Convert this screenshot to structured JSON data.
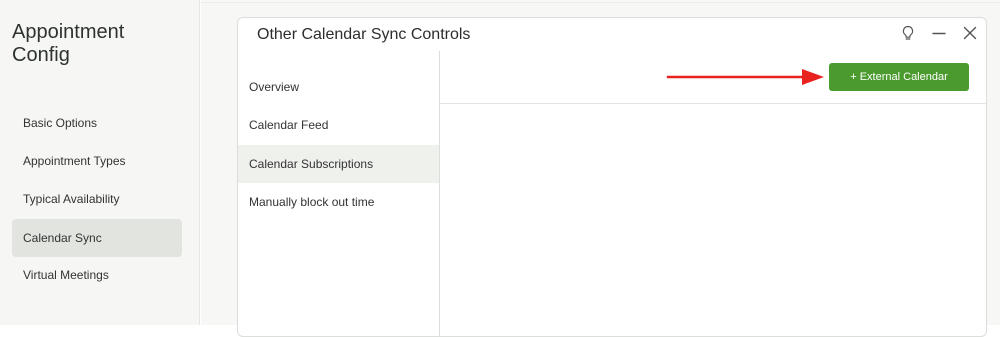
{
  "sidebar": {
    "title": "Appointment\nConfig",
    "items": [
      {
        "label": "Basic Options"
      },
      {
        "label": "Appointment Types"
      },
      {
        "label": "Typical Availability"
      },
      {
        "label": "Calendar Sync",
        "active": true
      },
      {
        "label": "Virtual Meetings"
      }
    ]
  },
  "panel": {
    "title": "Other Calendar Sync Controls",
    "controls": {
      "help_icon": "lightbulb-icon",
      "minimize_icon": "minimize-icon",
      "close_icon": "close-icon"
    },
    "tabs": [
      {
        "label": "Overview"
      },
      {
        "label": "Calendar Feed"
      },
      {
        "label": "Calendar Subscriptions",
        "active": true
      },
      {
        "label": "Manually block out time"
      }
    ],
    "add_button_label": "+ External Calendar"
  },
  "annotation": {
    "icon": "arrow-right-icon",
    "color": "#e8231f"
  },
  "colors": {
    "accent": "#4a9a2e",
    "sidebar_bg": "#f6f7f4",
    "active_nav_bg": "#e2e4df"
  }
}
